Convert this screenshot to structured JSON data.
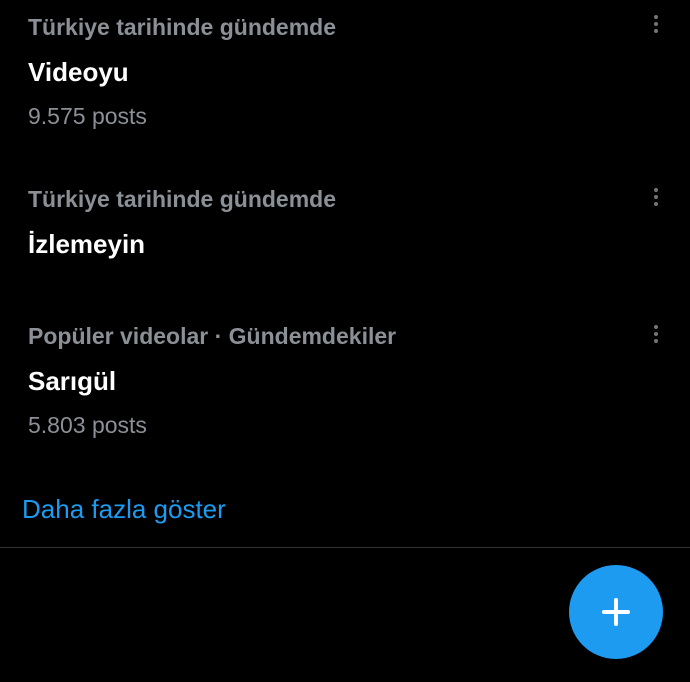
{
  "trends": [
    {
      "context": "Türkiye tarihinde gündemde",
      "name": "Videoyu",
      "count": "9.575 posts"
    },
    {
      "context": "Türkiye tarihinde gündemde",
      "name": "İzlemeyin"
    },
    {
      "context": "Popüler videolar · Gündemdekiler",
      "name": "Sarıgül",
      "count": "5.803 posts"
    }
  ],
  "show_more_label": "Daha fazla göster",
  "colors": {
    "background": "#000000",
    "primary_text": "#ffffff",
    "secondary_text": "#8b9096",
    "accent": "#1d9bf0",
    "divider": "#2f3336"
  },
  "icons": {
    "more": "more-vertical-icon",
    "compose": "plus-icon"
  }
}
